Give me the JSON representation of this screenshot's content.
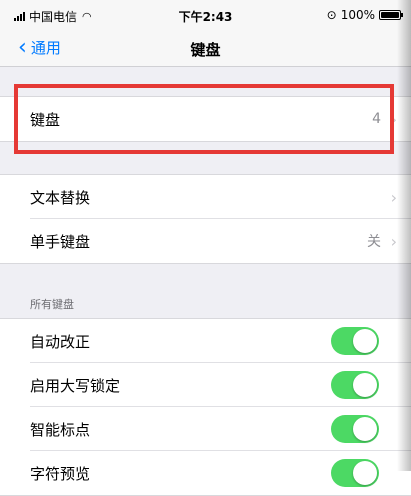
{
  "status_bar": {
    "carrier": "中国电信",
    "time": "下午2:43",
    "battery": "100%"
  },
  "nav": {
    "back_label": "通用",
    "title": "键盘"
  },
  "keyboards_row": {
    "label": "键盘",
    "value": "4"
  },
  "text_group": [
    {
      "label": "文本替换",
      "value": ""
    },
    {
      "label": "单手键盘",
      "value": "关"
    }
  ],
  "all_keyboards": {
    "header": "所有键盘",
    "items": [
      {
        "label": "自动改正",
        "on": true
      },
      {
        "label": "启用大写锁定",
        "on": true
      },
      {
        "label": "智能标点",
        "on": true
      },
      {
        "label": "字符预览",
        "on": true
      }
    ]
  },
  "colors": {
    "accent": "#007aff",
    "toggle_on": "#4cd964",
    "highlight": "#e53935"
  }
}
